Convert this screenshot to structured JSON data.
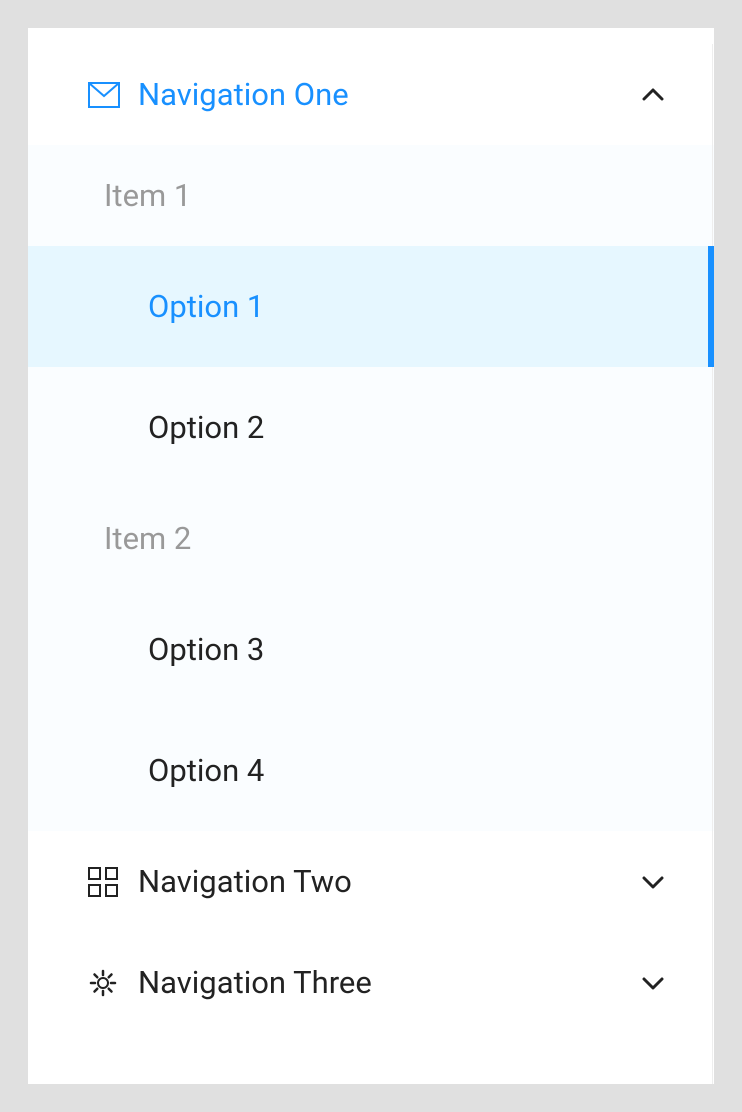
{
  "nav": [
    {
      "label": "Navigation One",
      "icon": "mail-icon",
      "expanded": true,
      "active": true,
      "groups": [
        {
          "title": "Item 1",
          "options": [
            {
              "label": "Option 1",
              "selected": true
            },
            {
              "label": "Option 2",
              "selected": false
            }
          ]
        },
        {
          "title": "Item 2",
          "options": [
            {
              "label": "Option 3",
              "selected": false
            },
            {
              "label": "Option 4",
              "selected": false
            }
          ]
        }
      ]
    },
    {
      "label": "Navigation Two",
      "icon": "appstore-icon",
      "expanded": false,
      "active": false
    },
    {
      "label": "Navigation Three",
      "icon": "gear-icon",
      "expanded": false,
      "active": false
    }
  ],
  "colors": {
    "accent": "#1890ff",
    "selected_bg": "#e6f7ff",
    "text": "#222",
    "muted": "#999"
  }
}
